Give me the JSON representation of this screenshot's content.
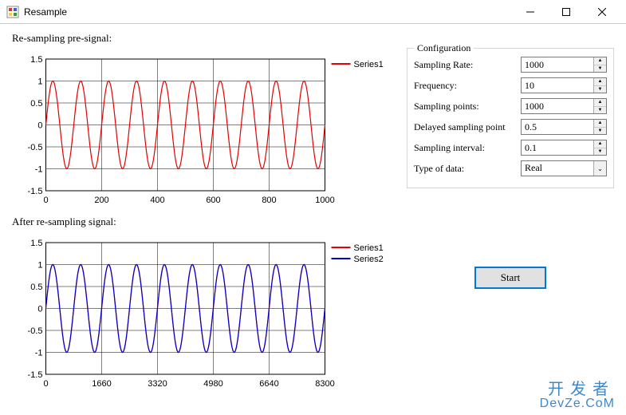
{
  "window": {
    "title": "Resample"
  },
  "labels": {
    "pre_signal": "Re-sampling pre-signal:",
    "after_signal": "After re-sampling signal:"
  },
  "config": {
    "legend": "Configuration",
    "sampling_rate": {
      "label": "Sampling Rate:",
      "value": "1000"
    },
    "frequency": {
      "label": "Frequency:",
      "value": "10"
    },
    "sampling_points": {
      "label": "Sampling points:",
      "value": "1000"
    },
    "delayed_point": {
      "label": "Delayed sampling point",
      "value": "0.5"
    },
    "sampling_interval": {
      "label": "Sampling interval:",
      "value": "0.1"
    },
    "type_of_data": {
      "label": "Type of data:",
      "value": "Real"
    }
  },
  "buttons": {
    "start": "Start"
  },
  "watermark": {
    "zh": "开发者",
    "en": "DevZe.CoM"
  },
  "chart_data": [
    {
      "type": "line",
      "title": "",
      "xlabel": "",
      "ylabel": "",
      "xlim": [
        0,
        1000
      ],
      "ylim": [
        -1.5,
        1.5
      ],
      "xticks": [
        0,
        200,
        400,
        600,
        800,
        1000
      ],
      "yticks": [
        -1.5,
        -1,
        -0.5,
        0,
        0.5,
        1,
        1.5
      ],
      "series": [
        {
          "name": "Series1",
          "color": "#e60000",
          "function": "sin",
          "amplitude": 1.0,
          "cycles": 10,
          "samples": 1000
        }
      ]
    },
    {
      "type": "line",
      "title": "",
      "xlabel": "",
      "ylabel": "",
      "xlim": [
        0,
        8300
      ],
      "ylim": [
        -1.5,
        1.5
      ],
      "xticks": [
        0,
        1660,
        3320,
        4980,
        6640,
        8300
      ],
      "yticks": [
        -1.5,
        -1,
        -0.5,
        0,
        0.5,
        1,
        1.5
      ],
      "series": [
        {
          "name": "Series1",
          "color": "#e60000",
          "function": "sin",
          "amplitude": 1.0,
          "cycles": 10,
          "samples": 8300
        },
        {
          "name": "Series2",
          "color": "#0000d6",
          "function": "sin",
          "amplitude": 1.0,
          "cycles": 10,
          "samples": 8300
        }
      ]
    }
  ]
}
